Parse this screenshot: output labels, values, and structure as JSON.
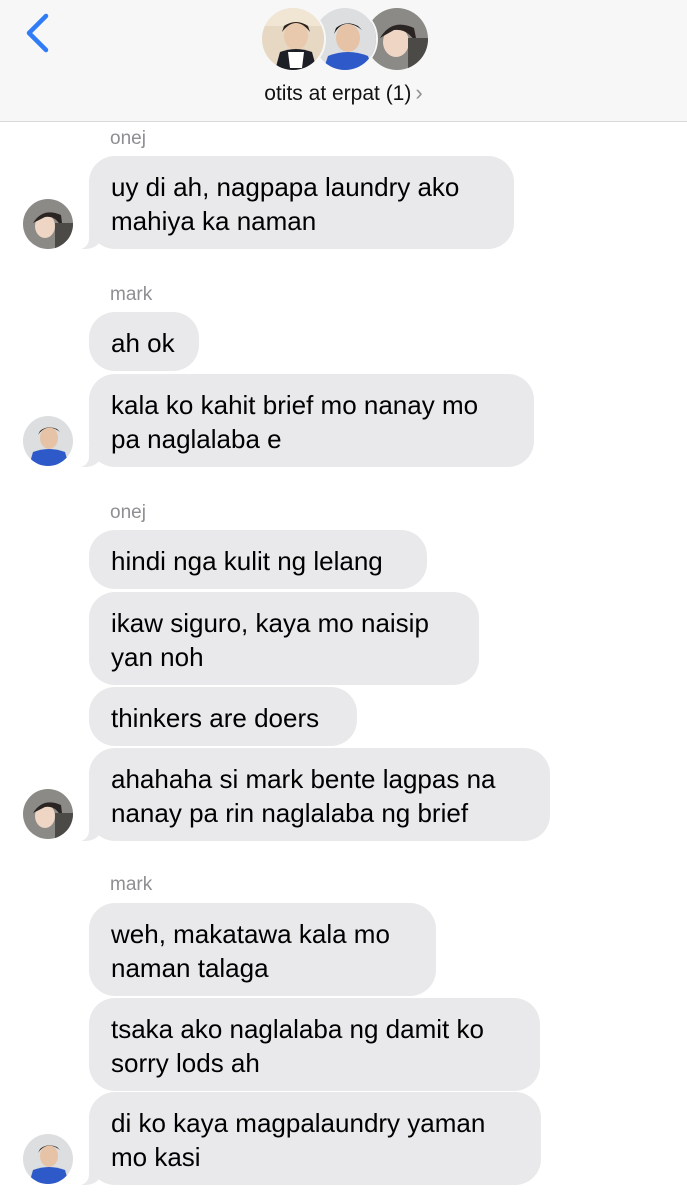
{
  "header": {
    "title": "otits at erpat (1)",
    "chevron": "›",
    "back_icon": "chevron-left-icon",
    "accent_color": "#2f7cf6"
  },
  "messages": [
    {
      "sender": "onej",
      "texts": [
        "uy di ah, nagpapa laundry ako\nmahiya ka naman"
      ]
    },
    {
      "sender": "mark",
      "texts": [
        "ah ok",
        "kala ko kahit brief mo nanay mo\npa naglalaba e"
      ]
    },
    {
      "sender": "onej",
      "texts": [
        "hindi nga kulit ng lelang",
        "ikaw siguro, kaya mo naisip\nyan noh",
        "thinkers are doers",
        "ahahaha si mark bente lagpas na\nnanay pa rin naglalaba ng brief"
      ]
    },
    {
      "sender": "mark",
      "texts": [
        "weh, makatawa kala mo\nnaman talaga",
        "tsaka ako naglalaba ng damit ko\nsorry lods ah",
        "di ko kaya magpalaundry yaman\nmo kasi"
      ]
    }
  ],
  "colors": {
    "bubble_bg": "#e9e9eb",
    "header_bg": "#f7f7f7",
    "sender_text": "#8e8e93"
  }
}
